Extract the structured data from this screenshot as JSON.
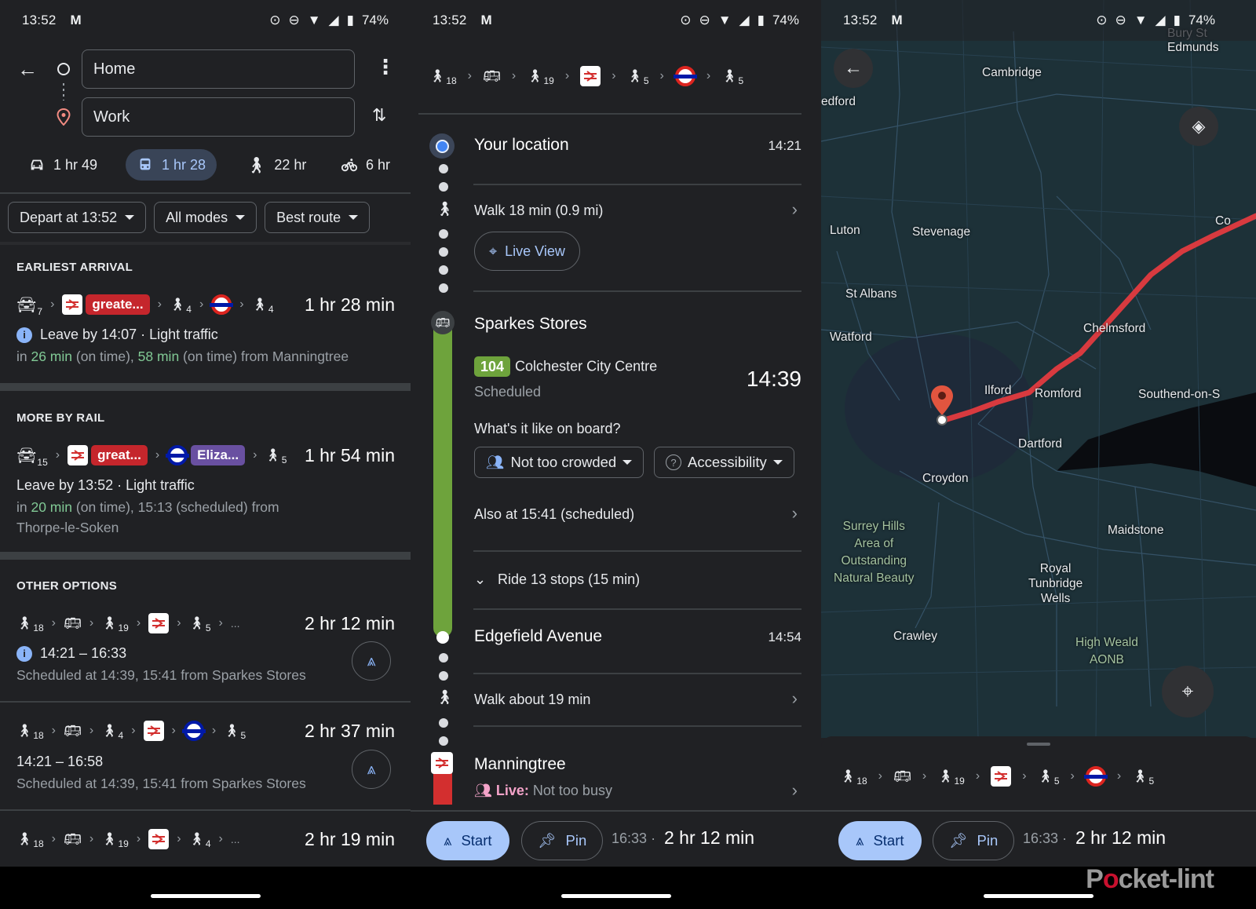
{
  "status_bar": {
    "time": "13:52",
    "battery": "74%",
    "icons": [
      "gmail-icon",
      "location-icon",
      "dnd-icon",
      "wifi-icon",
      "signal-icon",
      "battery-icon"
    ]
  },
  "panel1": {
    "origin": "Home",
    "destination": "Work",
    "modes": [
      {
        "icon": "car-icon",
        "label": "1 hr 49",
        "active": false
      },
      {
        "icon": "transit-icon",
        "label": "1 hr 28",
        "active": true
      },
      {
        "icon": "walk-icon",
        "label": "22 hr",
        "active": false
      },
      {
        "icon": "bike-icon",
        "label": "6 hr",
        "active": false
      }
    ],
    "filters": [
      "Depart at 13:52",
      "All modes",
      "Best route"
    ],
    "earliest": {
      "title": "EARLIEST ARRIVAL",
      "car_min": "7",
      "rail_line": "greate...",
      "walk1": "4",
      "walk2": "4",
      "duration": "1 hr 28 min",
      "info": "Leave by 14:07 · Light traffic",
      "sub_pre": "in ",
      "sub_g1": "26 min",
      "sub_mid": " (on time), ",
      "sub_g2": "58 min",
      "sub_post": " (on time) from Manningtree"
    },
    "more_rail": {
      "title": "MORE BY RAIL",
      "car_min": "15",
      "rail_line": "great...",
      "tube_line": "Eliza...",
      "walk": "5",
      "duration": "1 hr 54 min",
      "info": "Leave by 13:52 · Light traffic",
      "sub_pre": "in ",
      "sub_g1": "20 min",
      "sub_post": " (on time), 15:13 (scheduled) from",
      "sub_line2": "Thorpe-le-Soken"
    },
    "other": {
      "title": "OTHER OPTIONS",
      "options": [
        {
          "walks": [
            "18",
            "19",
            "5"
          ],
          "duration": "2 hr 12 min",
          "times": "14:21 – 16:33",
          "sub": "Scheduled at 14:39, 15:41 from Sparkes Stores",
          "ellipsis": "..."
        },
        {
          "walks": [
            "18",
            "4",
            "5"
          ],
          "duration": "2 hr 37 min",
          "times": "14:21 – 16:58",
          "sub": "Scheduled at 14:39, 15:41 from Sparkes Stores"
        },
        {
          "walks": [
            "18",
            "19",
            "4"
          ],
          "duration": "2 hr 19 min",
          "ellipsis": "..."
        }
      ]
    }
  },
  "panel2": {
    "steps": [
      "18",
      "19",
      "5",
      "5"
    ],
    "your_location": "Your location",
    "your_location_time": "14:21",
    "walk1": "Walk 18 min (0.9 mi)",
    "live_view": "Live View",
    "stop1": "Sparkes Stores",
    "bus_number": "104",
    "bus_dest": "Colchester City Centre",
    "bus_status": "Scheduled",
    "bus_time": "14:39",
    "onboard_q": "What's it like on board?",
    "crowd": "Not too crowded",
    "accessibility": "Accessibility",
    "also_at": "Also at 15:41 (scheduled)",
    "ride": "Ride 13 stops (15 min)",
    "stop2": "Edgefield Avenue",
    "stop2_time": "14:54",
    "walk2": "Walk about 19 min",
    "station": "Manningtree",
    "live_label": "Live:",
    "live_text": " Not too busy",
    "start": "Start",
    "pin": "Pin",
    "eta": "16:33",
    "sep": "·",
    "duration": "2 hr 12 min"
  },
  "panel3": {
    "labels": {
      "bury": "Bury St",
      "edmunds": "Edmunds",
      "cambridge": "Cambridge",
      "bedford": "edford",
      "luton": "Luton",
      "stevenage": "Stevenage",
      "st_albans": "St Albans",
      "watford": "Watford",
      "chelmsford": "Chelmsford",
      "colchester": "Co",
      "ilford": "Ilford",
      "romford": "Romford",
      "southend": "Southend-on-S",
      "dartford": "Dartford",
      "croydon": "Croydon",
      "maidstone": "Maidstone",
      "surrey": "Surrey Hills\nArea of\nOutstanding\nNatural Beauty",
      "tunbridge": "Royal\nTunbridge\nWells",
      "crawley": "Crawley",
      "weald": "High Weald\nAONB"
    },
    "steps": [
      "18",
      "19",
      "5",
      "5"
    ],
    "start": "Start",
    "pin": "Pin",
    "eta": "16:33",
    "sep": "·",
    "duration": "2 hr 12 min",
    "watermark_a": "P",
    "watermark_o": "o",
    "watermark_b": "cket-lint"
  },
  "colors": {
    "route": "#d83a3f",
    "bus_line": "#6ea33c",
    "accent": "#a8c7fa",
    "rail_red": "#c5262c",
    "elizabeth": "#6950a1"
  }
}
